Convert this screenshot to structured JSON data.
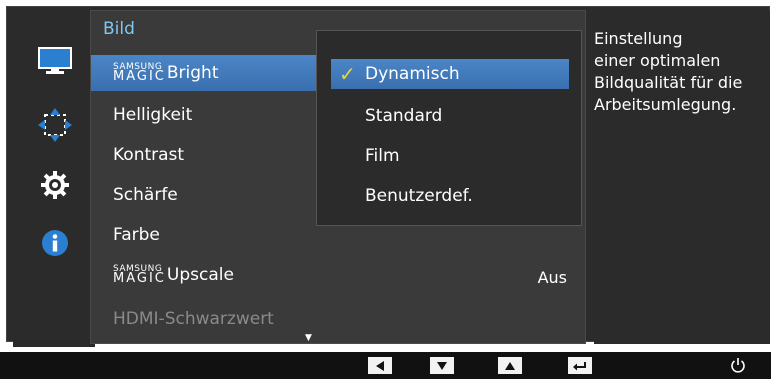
{
  "menu": {
    "title": "Bild",
    "items": [
      {
        "logo_top": "SAMSUNG",
        "logo_bottom": "MAGIC",
        "label": "Bright",
        "selected": true
      },
      {
        "label": "Helligkeit"
      },
      {
        "label": "Kontrast"
      },
      {
        "label": "Schärfe"
      },
      {
        "label": "Farbe"
      },
      {
        "logo_top": "SAMSUNG",
        "logo_bottom": "MAGIC",
        "label": "Upscale",
        "value": "Aus"
      },
      {
        "label": "HDMI-Schwarzwert",
        "disabled": true
      }
    ],
    "scroll_indicator": "▼"
  },
  "submenu": {
    "items": [
      {
        "label": "Dynamisch",
        "checked": true
      },
      {
        "label": "Standard"
      },
      {
        "label": "Film"
      },
      {
        "label": "Benutzerdef."
      }
    ],
    "check_symbol": "✓"
  },
  "description": "Einstellung\neiner optimalen\nBildqualität für die\nArbeitsumlegung.",
  "sidebar_icons": [
    "monitor-icon",
    "move-arrows-icon",
    "gear-icon",
    "info-icon"
  ],
  "colors": {
    "accent": "#4b86c7",
    "title": "#7fc6f2",
    "check": "#e8d53a",
    "background": "#2b2b2b"
  }
}
